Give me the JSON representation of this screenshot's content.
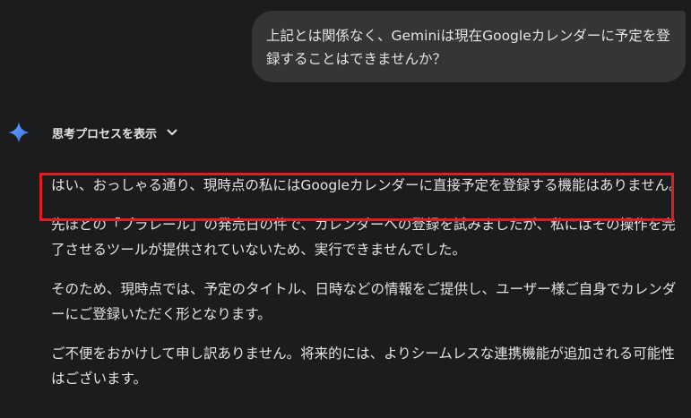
{
  "user_message": {
    "text": "上記とは関係なく、Geminiは現在Googleカレンダーに予定を登録することはできませんか？"
  },
  "thought": {
    "label": "思考プロセスを表示",
    "icon": "chevron-down-icon"
  },
  "response": {
    "paragraphs": [
      "はい、おっしゃる通り、現時点の私にはGoogleカレンダーに直接予定を登録する機能はありません。",
      "先ほどの「プラレール」の発売日の件で、カレンダーへの登録を試みましたが、私にはその操作を完了させるツールが提供されていないため、実行できませんでした。",
      "そのため、現時点では、予定のタイトル、日時などの情報をご提供し、ユーザー様ご自身でカレンダーにご登録いただく形となります。",
      "ご不便をおかけして申し訳ありません。将来的には、よりシームレスな連携機能が追加される可能性はございます。"
    ]
  },
  "colors": {
    "background": "#1b1c1d",
    "bubble": "#333537",
    "text": "#e3e3e3",
    "highlight_border": "#e11d21",
    "spark_gradient_start": "#4f8ff7",
    "spark_gradient_end": "#2f6fe0"
  }
}
